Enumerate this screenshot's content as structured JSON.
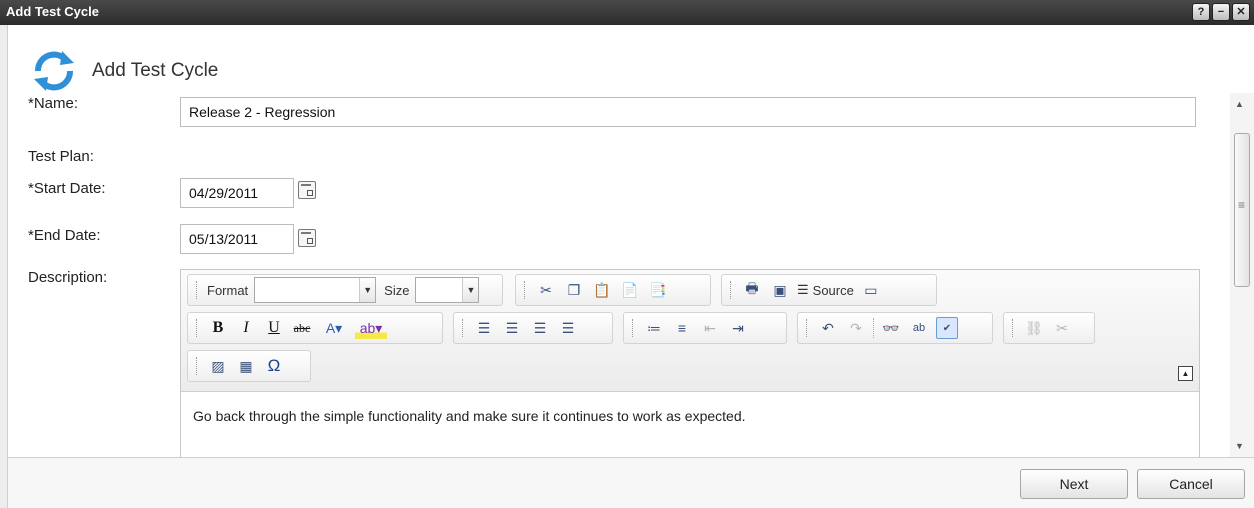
{
  "window": {
    "title": "Add Test Cycle",
    "buttons": {
      "help": "?",
      "minimize": "−",
      "close": "✕"
    }
  },
  "header": {
    "title": "Add Test Cycle",
    "icon": "refresh-cycle-icon"
  },
  "form": {
    "name_label": "*Name:",
    "name_value": "Release 2 - Regression",
    "test_plan_label": "Test Plan:",
    "start_date_label": "*Start Date:",
    "start_date_value": "04/29/2011",
    "end_date_label": "*End Date:",
    "end_date_value": "05/13/2011",
    "description_label": "Description:"
  },
  "editor": {
    "format_label": "Format",
    "size_label": "Size",
    "source_label": "Source",
    "content": "Go back through the simple functionality and make sure it continues to work as expected."
  },
  "footer": {
    "next_label": "Next",
    "cancel_label": "Cancel"
  },
  "colors": {
    "titlebar": "#333333",
    "accent_blue": "#2f8fd8"
  }
}
